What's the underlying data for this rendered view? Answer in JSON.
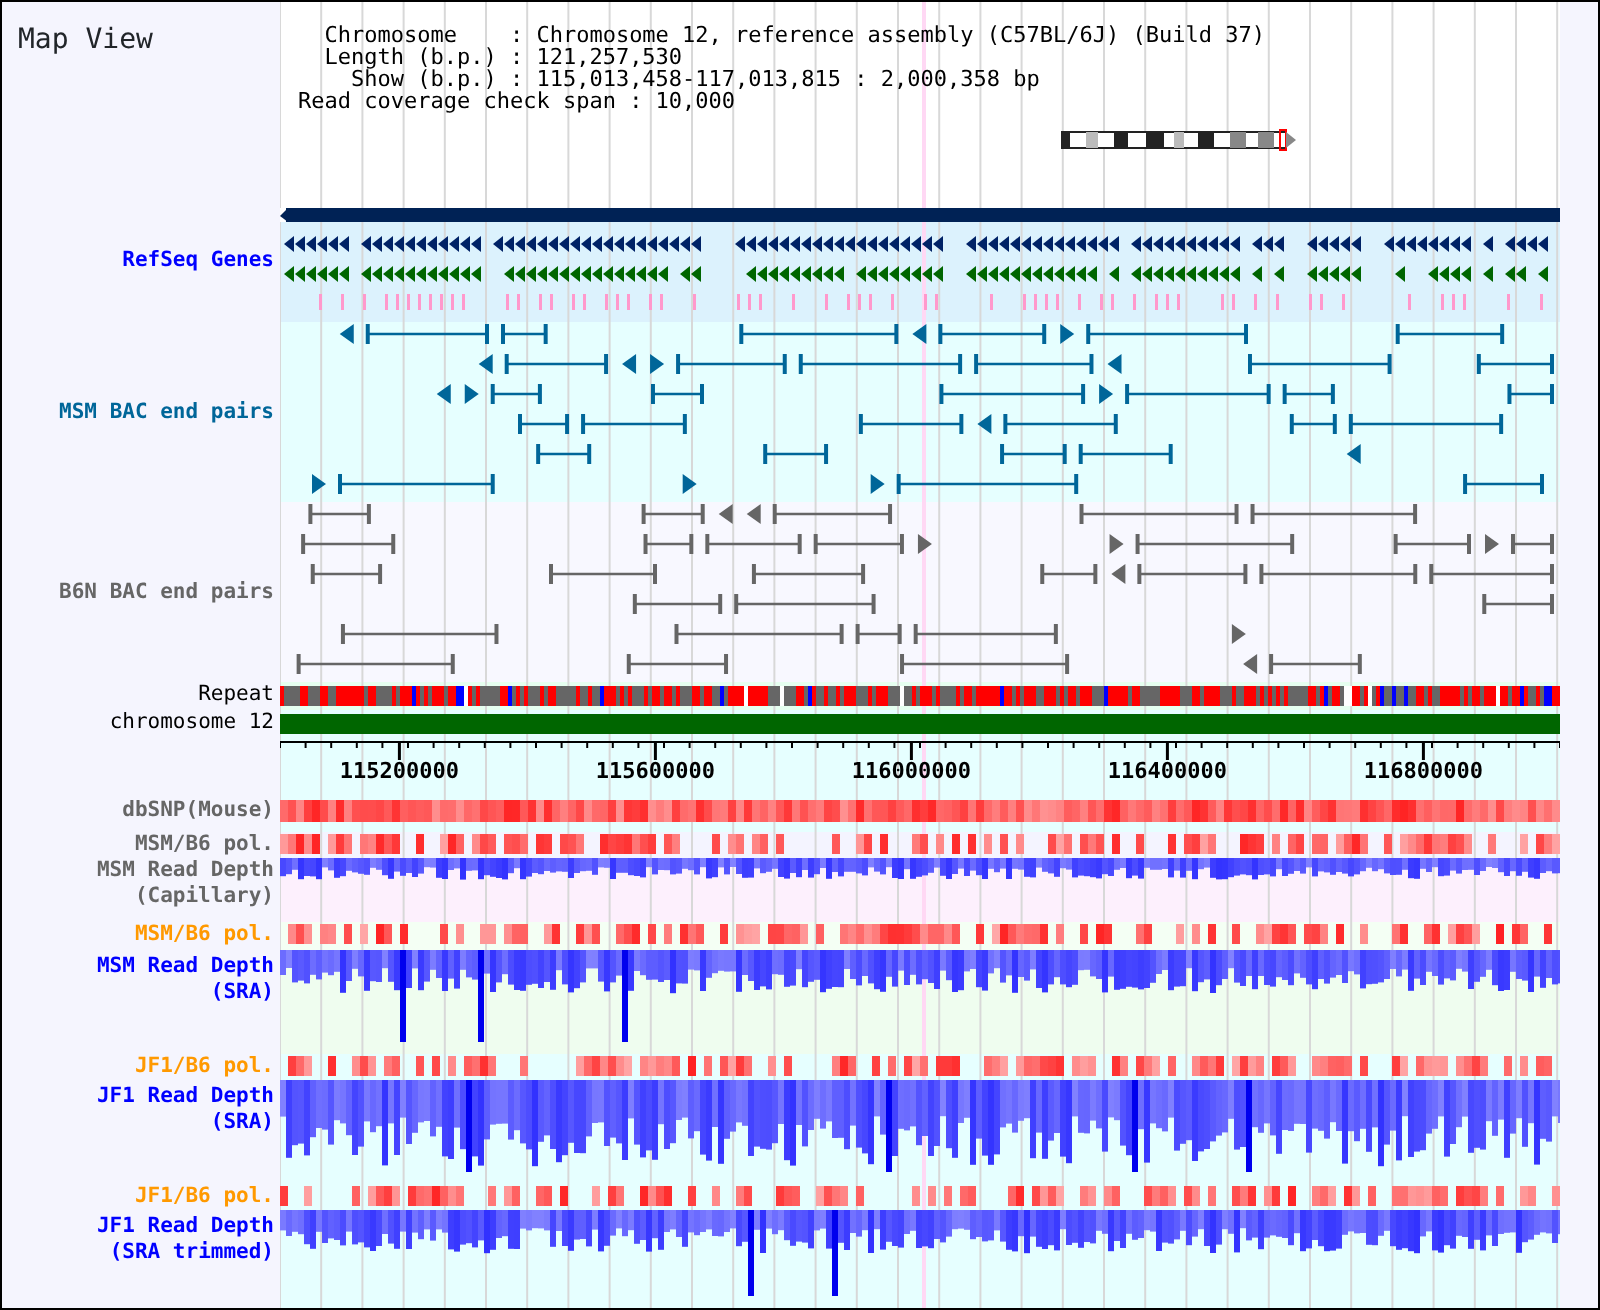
{
  "title": "Map View",
  "header_lines": [
    "  Chromosome    : Chromosome 12, reference assembly (C57BL/6J) (Build 37)",
    "  Length (b.p.) : 121,257,530",
    "    Show (b.p.) : 115,013,458-117,013,815 : 2,000,358 bp",
    "Read coverage check span : 10,000"
  ],
  "tracks": [
    {
      "kind": "genes",
      "label": [
        "RefSeq Genes"
      ],
      "color": "#0000ff"
    },
    {
      "kind": "bac",
      "label": [
        "MSM BAC end pairs"
      ],
      "color": "#006699"
    },
    {
      "kind": "bac",
      "label": [
        "B6N BAC end pairs"
      ],
      "color": "#666666"
    },
    {
      "kind": "repeat",
      "label": [
        "Repeat"
      ],
      "color": "#000000"
    },
    {
      "kind": "chromosome",
      "label": [
        "chromosome 12"
      ],
      "color": "#000000"
    },
    {
      "kind": "axis",
      "ticks": [
        "115200000",
        "115600000",
        "116000000",
        "116400000",
        "116800000"
      ]
    },
    {
      "kind": "snp",
      "label": [
        "dbSNP(Mouse)"
      ],
      "color": "#666666"
    },
    {
      "kind": "pol",
      "label": [
        "MSM/B6 pol."
      ],
      "color": "#666666"
    },
    {
      "kind": "depth",
      "label": [
        "MSM Read Depth",
        "(Capillary)"
      ],
      "color": "#666666"
    },
    {
      "kind": "pol",
      "label": [
        "MSM/B6 pol."
      ],
      "color": "#ff9900"
    },
    {
      "kind": "depth",
      "label": [
        "MSM Read Depth",
        "(SRA)"
      ],
      "color": "#0000ff"
    },
    {
      "kind": "pol",
      "label": [
        "JF1/B6 pol."
      ],
      "color": "#ff9900"
    },
    {
      "kind": "depth",
      "label": [
        "JF1 Read Depth",
        "(SRA)"
      ],
      "color": "#0000ff"
    },
    {
      "kind": "pol",
      "label": [
        "JF1/B6 pol."
      ],
      "color": "#ff9900"
    },
    {
      "kind": "depth",
      "label": [
        "JF1 Read Depth",
        "(SRA trimmed)"
      ],
      "color": "#0000ff"
    }
  ]
}
